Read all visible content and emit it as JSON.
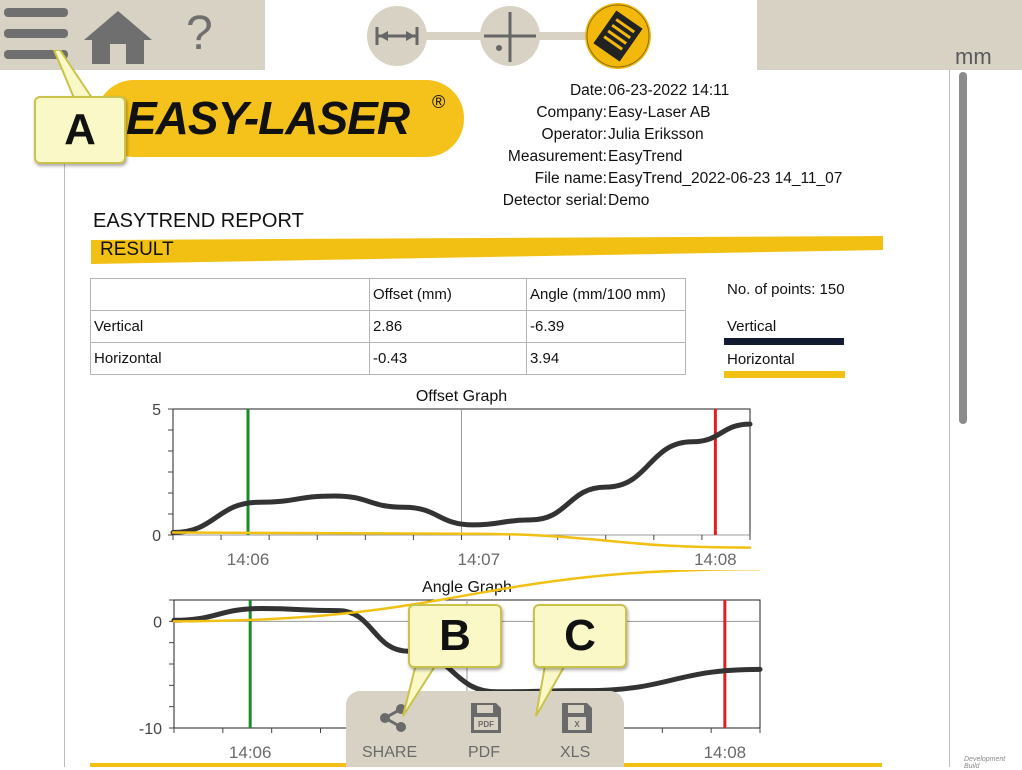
{
  "topbar": {
    "menu_icon": "hamburger-menu-icon",
    "home_icon": "home-icon",
    "help_label": "?",
    "unit": "mm",
    "steps": [
      "measure-distance-icon",
      "crosshair-icon",
      "report-icon"
    ]
  },
  "logo": {
    "text": "EASY-LASER",
    "reg": "®"
  },
  "header": {
    "fields": [
      {
        "label": "Date:",
        "value": "06-23-2022 14:11"
      },
      {
        "label": "Company:",
        "value": "Easy-Laser AB"
      },
      {
        "label": "Operator:",
        "value": "Julia Eriksson"
      },
      {
        "label": "Measurement:",
        "value": "EasyTrend"
      },
      {
        "label": "File name:",
        "value": "EasyTrend_2022-06-23 14_11_07"
      },
      {
        "label": "Detector serial:",
        "value": "Demo"
      }
    ]
  },
  "report": {
    "title": "EASYTREND REPORT",
    "section": "RESULT",
    "table": {
      "headers": [
        "",
        "Offset (mm)",
        "Angle (mm/100 mm)"
      ],
      "rows": [
        [
          "Vertical",
          "2.86",
          "-6.39"
        ],
        [
          "Horizontal",
          "-0.43",
          "3.94"
        ]
      ]
    },
    "points_label": "No. of points: 150",
    "legend": [
      {
        "name": "Vertical",
        "color": "#111a2e"
      },
      {
        "name": "Horizontal",
        "color": "#f2c013"
      }
    ]
  },
  "chart_data": [
    {
      "type": "line",
      "title": "Offset Graph",
      "x_ticks": [
        "14:06",
        "14:07",
        "14:08"
      ],
      "ylim": [
        0,
        5
      ],
      "y_ticks": [
        "5",
        "0"
      ],
      "markers": {
        "start": "14:06",
        "end": "14:08"
      },
      "series": [
        {
          "name": "Vertical",
          "color": "#333333",
          "x": [
            0,
            0.15,
            0.28,
            0.4,
            0.52,
            0.62,
            0.75,
            0.9,
            1
          ],
          "values": [
            0.1,
            1.3,
            1.55,
            1.1,
            0.4,
            0.6,
            1.9,
            3.7,
            4.4
          ]
        },
        {
          "name": "Horizontal",
          "color": "#f2c013",
          "x": [
            0,
            0.5,
            1
          ],
          "values": [
            0.1,
            0.05,
            -0.5
          ]
        }
      ]
    },
    {
      "type": "line",
      "title": "Angle Graph",
      "x_ticks": [
        "14:06",
        "14:07",
        "14:08"
      ],
      "ylim": [
        -10,
        2
      ],
      "y_ticks": [
        "0",
        "-10"
      ],
      "markers": {
        "start": "14:06",
        "end": "14:08"
      },
      "series": [
        {
          "name": "Vertical",
          "color": "#333333",
          "x": [
            0,
            0.15,
            0.28,
            0.4,
            0.55,
            0.7,
            1
          ],
          "values": [
            0.1,
            1.2,
            1.0,
            -2.8,
            -6.6,
            -6.5,
            -4.5
          ]
        },
        {
          "name": "Horizontal",
          "color": "#f2c013",
          "x": [
            0,
            1
          ],
          "values": [
            0,
            4.9
          ]
        }
      ]
    }
  ],
  "toolbar": {
    "share": "SHARE",
    "pdf": "PDF",
    "xls": "XLS"
  },
  "callouts": {
    "a": "A",
    "b": "B",
    "c": "C"
  },
  "footer_note": "Development Build"
}
